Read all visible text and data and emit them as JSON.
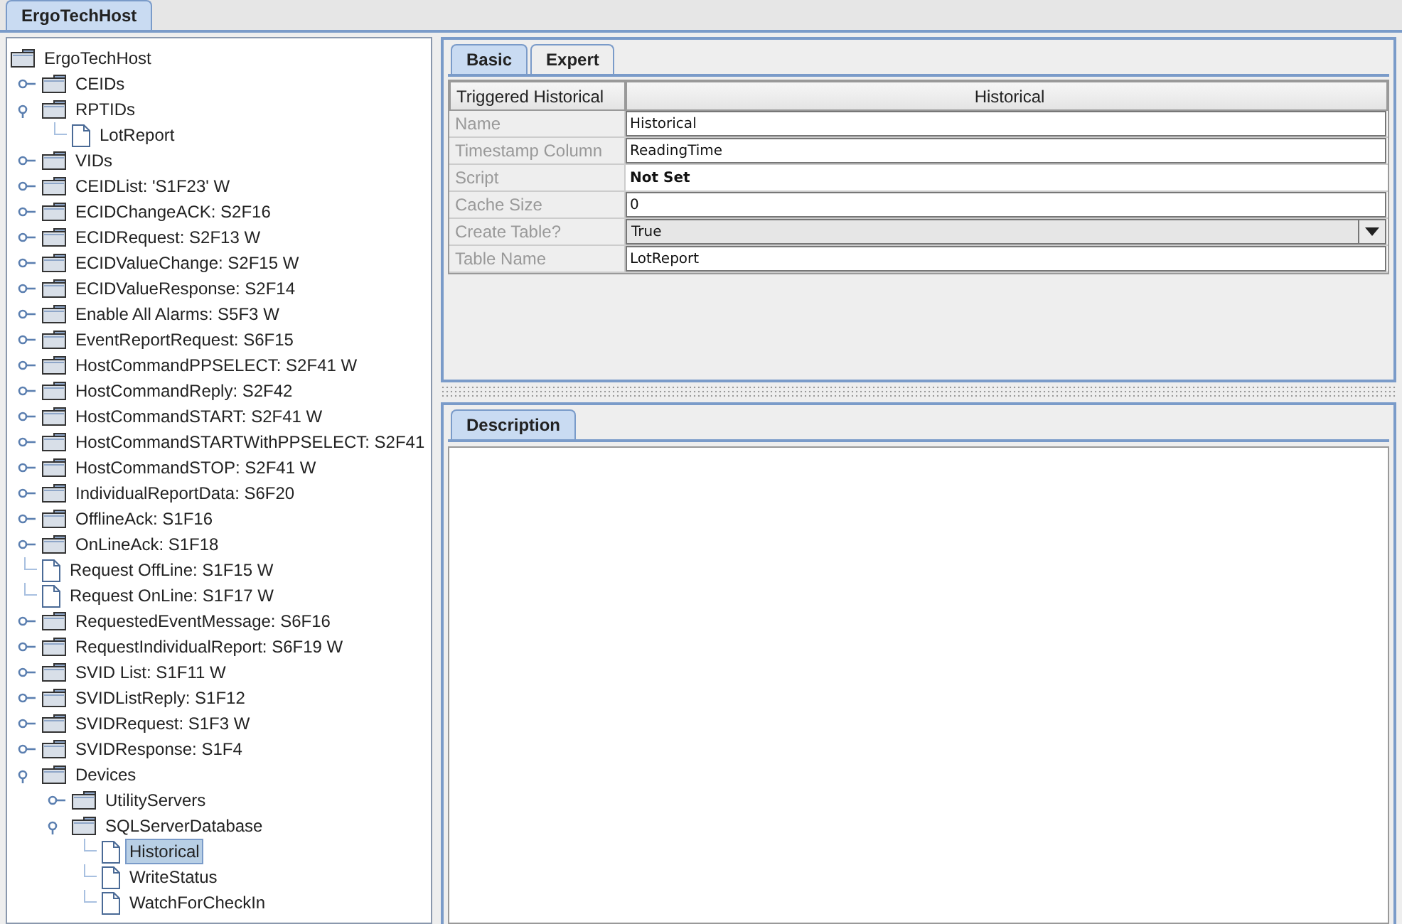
{
  "window_tab": {
    "label": "ErgoTechHost",
    "selected": true
  },
  "tree": {
    "label": "ErgoTechHost",
    "kind": "folder",
    "selected": false,
    "children": [
      {
        "label": "CEIDs",
        "kind": "folder",
        "expanded": false,
        "selected": false
      },
      {
        "label": "RPTIDs",
        "kind": "folder",
        "expanded": true,
        "selected": false,
        "children": [
          {
            "label": "LotReport",
            "kind": "file",
            "selected": false
          }
        ]
      },
      {
        "label": "VIDs",
        "kind": "folder",
        "expanded": false,
        "selected": false
      },
      {
        "label": "CEIDList: 'S1F23' W",
        "kind": "folder",
        "expanded": false,
        "selected": false
      },
      {
        "label": "ECIDChangeACK: S2F16",
        "kind": "folder",
        "expanded": false,
        "selected": false
      },
      {
        "label": "ECIDRequest: S2F13 W",
        "kind": "folder",
        "expanded": false,
        "selected": false
      },
      {
        "label": "ECIDValueChange: S2F15 W",
        "kind": "folder",
        "expanded": false,
        "selected": false
      },
      {
        "label": "ECIDValueResponse: S2F14",
        "kind": "folder",
        "expanded": false,
        "selected": false
      },
      {
        "label": "Enable All Alarms: S5F3 W",
        "kind": "folder",
        "expanded": false,
        "selected": false
      },
      {
        "label": "EventReportRequest: S6F15",
        "kind": "folder",
        "expanded": false,
        "selected": false
      },
      {
        "label": "HostCommandPPSELECT: S2F41 W",
        "kind": "folder",
        "expanded": false,
        "selected": false
      },
      {
        "label": "HostCommandReply: S2F42",
        "kind": "folder",
        "expanded": false,
        "selected": false
      },
      {
        "label": "HostCommandSTART: S2F41 W",
        "kind": "folder",
        "expanded": false,
        "selected": false
      },
      {
        "label": "HostCommandSTARTWithPPSELECT: S2F41",
        "kind": "folder",
        "expanded": false,
        "selected": false
      },
      {
        "label": "HostCommandSTOP: S2F41 W",
        "kind": "folder",
        "expanded": false,
        "selected": false
      },
      {
        "label": "IndividualReportData: S6F20",
        "kind": "folder",
        "expanded": false,
        "selected": false
      },
      {
        "label": "OfflineAck: S1F16",
        "kind": "folder",
        "expanded": false,
        "selected": false
      },
      {
        "label": "OnLineAck: S1F18",
        "kind": "folder",
        "expanded": false,
        "selected": false
      },
      {
        "label": "Request OffLine: S1F15 W",
        "kind": "file",
        "selected": false
      },
      {
        "label": "Request OnLine: S1F17 W",
        "kind": "file",
        "selected": false
      },
      {
        "label": "RequestedEventMessage: S6F16",
        "kind": "folder",
        "expanded": false,
        "selected": false
      },
      {
        "label": "RequestIndividualReport: S6F19 W",
        "kind": "folder",
        "expanded": false,
        "selected": false
      },
      {
        "label": "SVID List: S1F11 W",
        "kind": "folder",
        "expanded": false,
        "selected": false
      },
      {
        "label": "SVIDListReply: S1F12",
        "kind": "folder",
        "expanded": false,
        "selected": false
      },
      {
        "label": "SVIDRequest: S1F3 W",
        "kind": "folder",
        "expanded": false,
        "selected": false
      },
      {
        "label": "SVIDResponse: S1F4",
        "kind": "folder",
        "expanded": false,
        "selected": false
      },
      {
        "label": "Devices",
        "kind": "folder",
        "expanded": true,
        "selected": false,
        "children": [
          {
            "label": "UtilityServers",
            "kind": "folder",
            "expanded": false,
            "selected": false
          },
          {
            "label": "SQLServerDatabase",
            "kind": "folder",
            "expanded": true,
            "selected": false,
            "children": [
              {
                "label": "Historical",
                "kind": "file",
                "selected": true
              },
              {
                "label": "WriteStatus",
                "kind": "file",
                "selected": false
              },
              {
                "label": "WatchForCheckIn",
                "kind": "file",
                "selected": false
              }
            ]
          }
        ]
      }
    ]
  },
  "property_tabs": [
    {
      "label": "Basic",
      "selected": true
    },
    {
      "label": "Expert",
      "selected": false
    }
  ],
  "properties": {
    "columns": [
      "Triggered Historical",
      "Historical"
    ],
    "rows": [
      {
        "label": "Name",
        "value": "Historical",
        "kind": "text"
      },
      {
        "label": "Timestamp Column",
        "value": "ReadingTime",
        "kind": "text"
      },
      {
        "label": "Script",
        "value": "Not Set",
        "kind": "static"
      },
      {
        "label": "Cache Size",
        "value": "0",
        "kind": "text"
      },
      {
        "label": "Create Table?",
        "value": "True",
        "kind": "select"
      },
      {
        "label": "Table Name",
        "value": "LotReport",
        "kind": "text"
      }
    ]
  },
  "description_tabs": [
    {
      "label": "Description",
      "selected": true
    }
  ]
}
